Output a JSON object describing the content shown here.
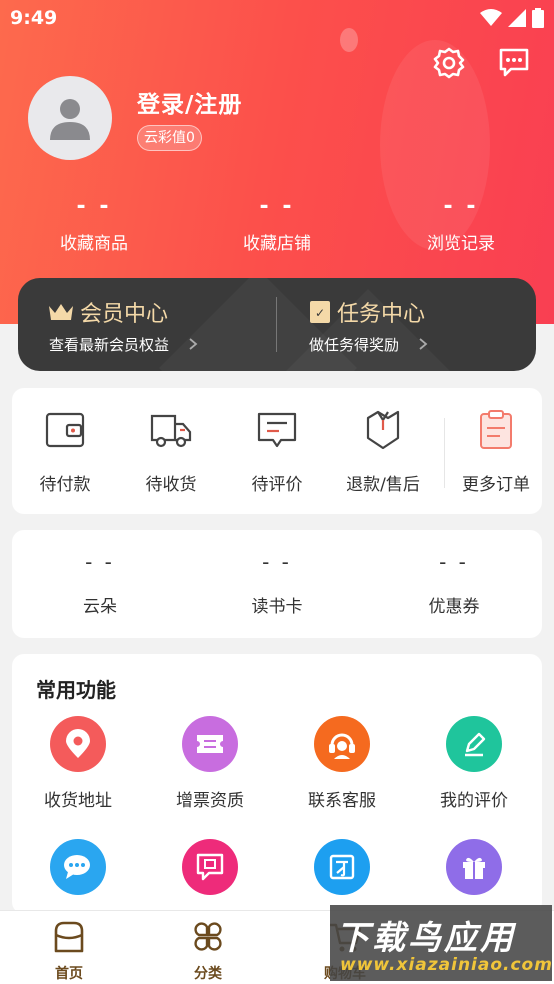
{
  "status": {
    "time": "9:49"
  },
  "profile": {
    "login_label": "登录/注册",
    "cloud_value": "云彩值0"
  },
  "stats": [
    {
      "value": "- -",
      "label": "收藏商品"
    },
    {
      "value": "- -",
      "label": "收藏店铺"
    },
    {
      "value": "- -",
      "label": "浏览记录"
    }
  ],
  "member": {
    "title": "会员中心",
    "subtitle": "查看最新会员权益"
  },
  "task": {
    "title": "任务中心",
    "subtitle": "做任务得奖励"
  },
  "orders": [
    {
      "label": "待付款",
      "icon": "wallet-icon"
    },
    {
      "label": "待收货",
      "icon": "truck-icon"
    },
    {
      "label": "待评价",
      "icon": "comment-icon"
    },
    {
      "label": "退款/售后",
      "icon": "refund-icon"
    },
    {
      "label": "更多订单",
      "icon": "clipboard-icon"
    }
  ],
  "assets": [
    {
      "value": "- -",
      "label": "云朵"
    },
    {
      "value": "- -",
      "label": "读书卡"
    },
    {
      "value": "- -",
      "label": "优惠券"
    }
  ],
  "functions": {
    "title": "常用功能",
    "items": [
      {
        "label": "收货地址",
        "icon": "location-pin-icon",
        "color": "#f45b5b"
      },
      {
        "label": "增票资质",
        "icon": "ticket-icon",
        "color": "#c86ddf"
      },
      {
        "label": "联系客服",
        "icon": "headset-icon",
        "color": "#f56a1f"
      },
      {
        "label": "我的评价",
        "icon": "pencil-icon",
        "color": "#1fc59c"
      },
      {
        "label": "",
        "icon": "chat-bubbles-icon",
        "color": "#2aa6f0"
      },
      {
        "label": "",
        "icon": "question-icon",
        "color": "#ee2b7a"
      },
      {
        "label": "",
        "icon": "framed-icon",
        "color": "#1d9ff0"
      },
      {
        "label": "",
        "icon": "gift-icon",
        "color": "#8f6de8"
      }
    ]
  },
  "tabs": [
    {
      "label": "首页",
      "icon": "home-basket-icon"
    },
    {
      "label": "分类",
      "icon": "category-icon"
    },
    {
      "label": "购物车",
      "icon": "cart-icon"
    }
  ],
  "watermark": {
    "line1": "下载鸟应用",
    "line2": "www.xiazainiao.com"
  },
  "colors": {
    "brand_red": "#fc4f4b",
    "dark_bar": "#3a3a3a",
    "gold": "#f4d9a8",
    "tab_brown": "#6b4a1e"
  }
}
